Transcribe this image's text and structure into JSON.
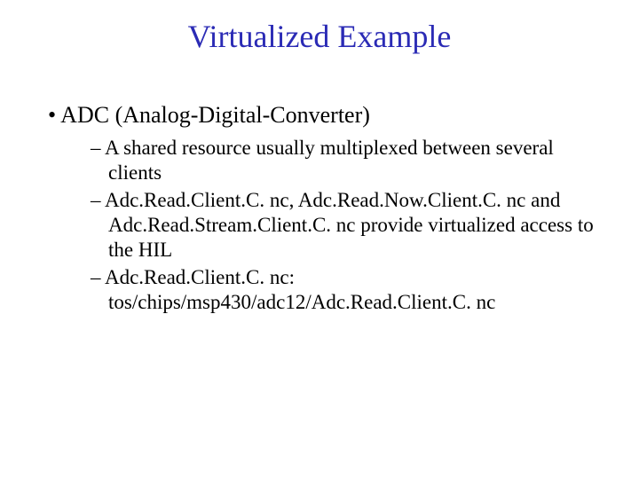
{
  "title": "Virtualized Example",
  "bullet1": "ADC (Analog-Digital-Converter)",
  "sub1": "A shared resource usually multiplexed between several clients",
  "sub2": "Adc.Read.Client.C. nc, Adc.Read.Now.Client.C. nc and Adc.Read.Stream.Client.C. nc provide virtualized access to the HIL",
  "sub3": "Adc.Read.Client.C. nc: tos/chips/msp430/adc12/Adc.Read.Client.C. nc"
}
